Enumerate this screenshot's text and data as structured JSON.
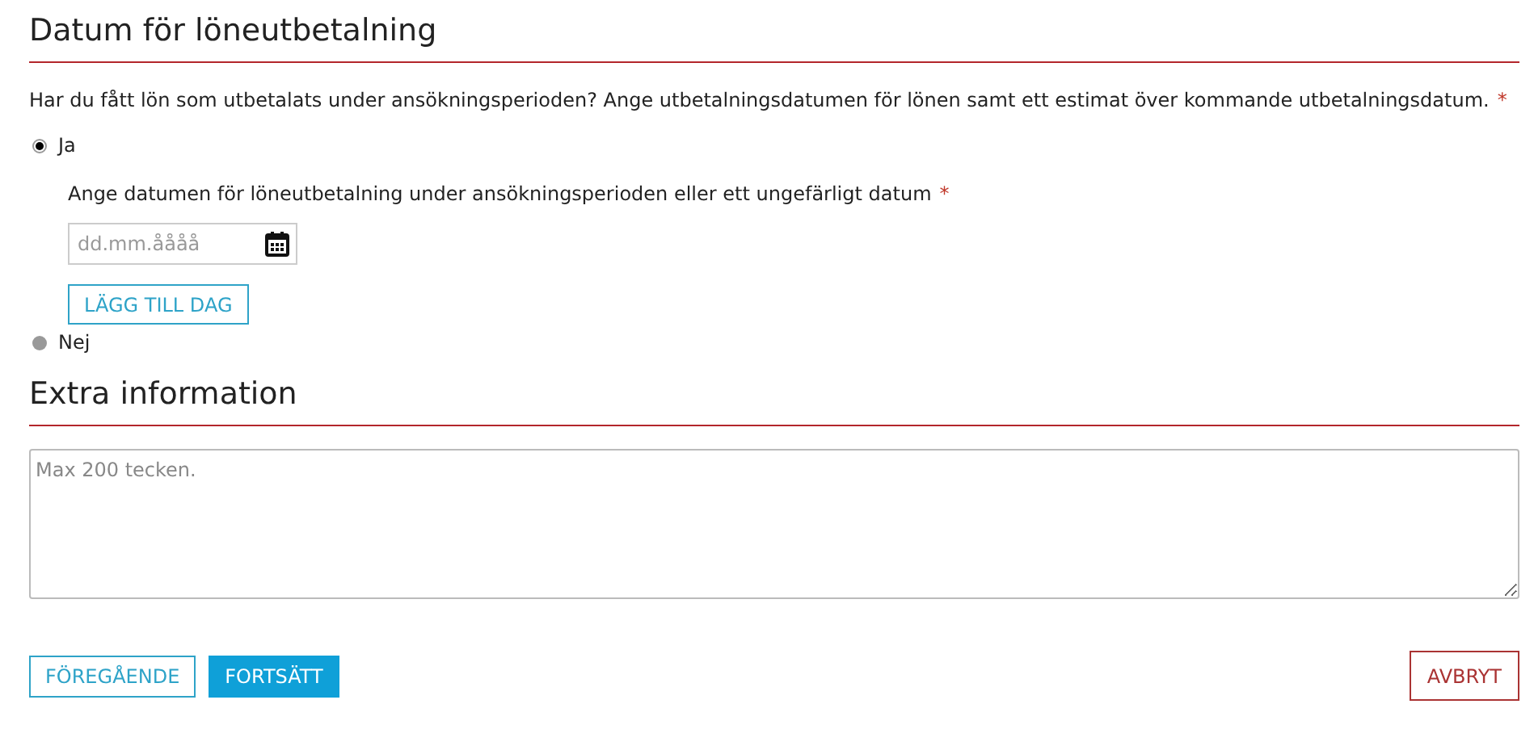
{
  "sections": [
    {
      "title": "Datum för löneutbetalning"
    },
    {
      "title": "Extra information"
    }
  ],
  "question": {
    "text": "Har du fått lön som utbetalats under ansökningsperioden? Ange utbetalningsdatumen för lönen samt ett estimat över kommande utbetalningsdatum.",
    "required": true,
    "required_mark": "*"
  },
  "options": [
    {
      "label": "Ja",
      "selected": true
    },
    {
      "label": "Nej",
      "selected": false
    }
  ],
  "date_question": {
    "text": "Ange datumen för löneutbetalning under ansökningsperioden eller ett ungefärligt datum",
    "required": true,
    "required_mark": "*"
  },
  "date_field": {
    "placeholder": "dd.mm.åååå"
  },
  "add_button": "LÄGG TILL DAG",
  "extra_field": {
    "placeholder": "Max 200 tecken."
  },
  "buttons": [
    {
      "label": "FÖREGÅENDE",
      "kind": "outline"
    },
    {
      "label": "FORTSÄTT",
      "kind": "primary"
    },
    {
      "label": "AVBRYT",
      "kind": "cancel"
    }
  ]
}
